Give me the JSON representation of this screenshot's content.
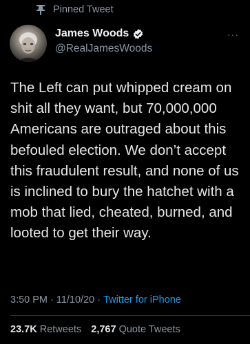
{
  "pinned_label": "Pinned Tweet",
  "author": {
    "name": "James Woods",
    "handle": "@RealJamesWoods"
  },
  "more_label": "···",
  "tweet_text": "The Left can put whipped cream on shit all they want, but 70,000,000 Americans are outraged about this befouled election. We don’t accept this fraudulent result, and none of us is inclined to bury the hatchet with a mob that lied, cheated, burned, and looted to get their way.",
  "meta": {
    "time": "3:50 PM",
    "separator": "·",
    "date": "11/10/20",
    "source": "Twitter for iPhone"
  },
  "stats": {
    "retweets_count": "23.7K",
    "retweets_label": "Retweets",
    "quotes_count": "2,767",
    "quotes_label": "Quote Tweets"
  },
  "colors": {
    "background": "#000000",
    "accent": "#1d9bf0",
    "muted": "#8b98a5"
  },
  "icons": {
    "pin": "pin-icon",
    "verified": "verified-badge-icon",
    "more": "more-options-icon"
  }
}
